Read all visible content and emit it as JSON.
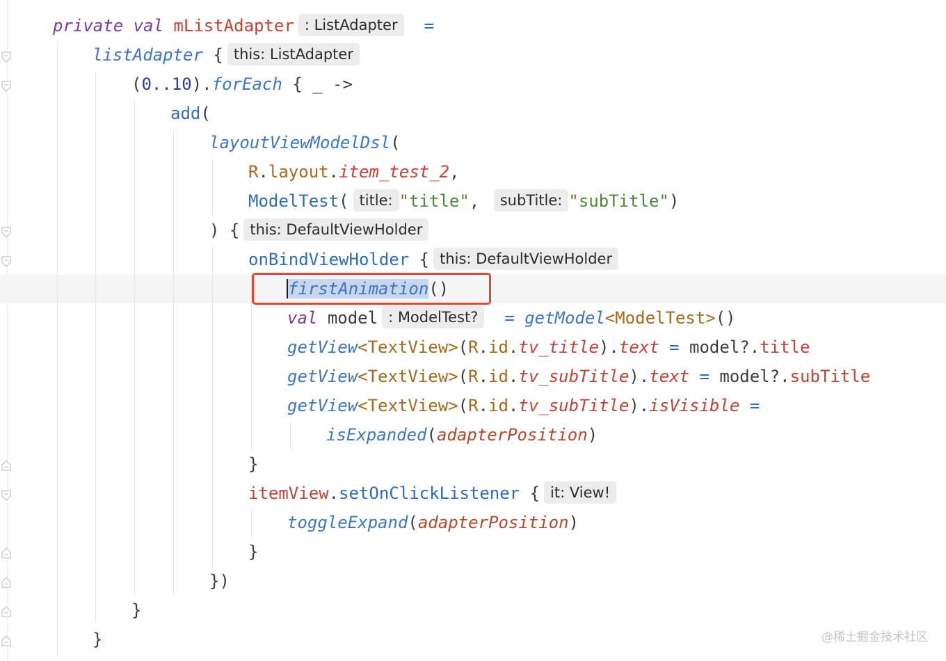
{
  "code": {
    "l1": {
      "kw_private": "private",
      "kw_val": "val",
      "name": "mListAdapter",
      "hint": ": ListAdapter",
      "eq": "="
    },
    "l2": {
      "fn": "listAdapter",
      "brace": "{",
      "hint": "this: ListAdapter"
    },
    "l3": {
      "open": "(",
      "num1": "0",
      "range": "..",
      "num2": "10",
      "close": ").",
      "fn": "forEach",
      "rest": "{ _ ->"
    },
    "l4": {
      "fn": "add",
      "paren": "("
    },
    "l5": {
      "fn": "layoutViewModelDsl",
      "paren": "("
    },
    "l6": {
      "r": "R",
      "dot1": ".",
      "layout": "layout",
      "dot2": ".",
      "field": "item_test_2",
      "comma": ","
    },
    "l7": {
      "cls": "ModelTest",
      "paren": "(",
      "hint1": "title:",
      "str1": "\"title\"",
      "comma": ",",
      "hint2": "subTitle:",
      "str2": "\"subTitle\"",
      "close": ")"
    },
    "l8": {
      "close": ") {",
      "hint": "this: DefaultViewHolder"
    },
    "l9": {
      "fn": "onBindViewHolder",
      "brace": "{",
      "hint": "this: DefaultViewHolder"
    },
    "l10": {
      "fn": "firstAnimation",
      "parens": "()"
    },
    "l11": {
      "kw": "val",
      "name": "model",
      "hint": ": ModelTest?",
      "eq": "=",
      "fn": "getModel",
      "lt": "<",
      "type": "ModelTest",
      "gt": ">",
      "parens": "()"
    },
    "l12": {
      "fn": "getView",
      "lt": "<",
      "type": "TextView",
      "gt": ">",
      "open": "(",
      "r": "R",
      "dot1": ".",
      "id": "id",
      "dot2": ".",
      "field": "tv_title",
      "close": ").",
      "prop": "text",
      "eq": "=",
      "model": "model?.",
      "mprop": "title"
    },
    "l13": {
      "fn": "getView",
      "lt": "<",
      "type": "TextView",
      "gt": ">",
      "open": "(",
      "r": "R",
      "dot1": ".",
      "id": "id",
      "dot2": ".",
      "field": "tv_subTitle",
      "close": ").",
      "prop": "text",
      "eq": "=",
      "model": "model?.",
      "mprop": "subTitle"
    },
    "l14": {
      "fn": "getView",
      "lt": "<",
      "type": "TextView",
      "gt": ">",
      "open": "(",
      "r": "R",
      "dot1": ".",
      "id": "id",
      "dot2": ".",
      "field": "tv_subTitle",
      "close": ").",
      "prop": "isVisible",
      "eq": "="
    },
    "l15": {
      "fn": "isExpanded",
      "open": "(",
      "arg": "adapterPosition",
      "close": ")"
    },
    "l16": {
      "brace": "}"
    },
    "l17": {
      "obj": "itemView",
      "dot": ".",
      "fn": "setOnClickListener",
      "brace": "{",
      "hint": "it: View!"
    },
    "l18": {
      "fn": "toggleExpand",
      "open": "(",
      "arg": "adapterPosition",
      "close": ")"
    },
    "l19": {
      "brace": "}"
    },
    "l20": {
      "close": "})"
    },
    "l21": {
      "brace": "}"
    },
    "l22": {
      "brace": "}"
    }
  },
  "watermark": "@稀土掘金技术社区",
  "colors": {
    "highlight_box": "#df4a38",
    "selection": "#c7d6ec",
    "current_line": "#f5f5f5"
  }
}
